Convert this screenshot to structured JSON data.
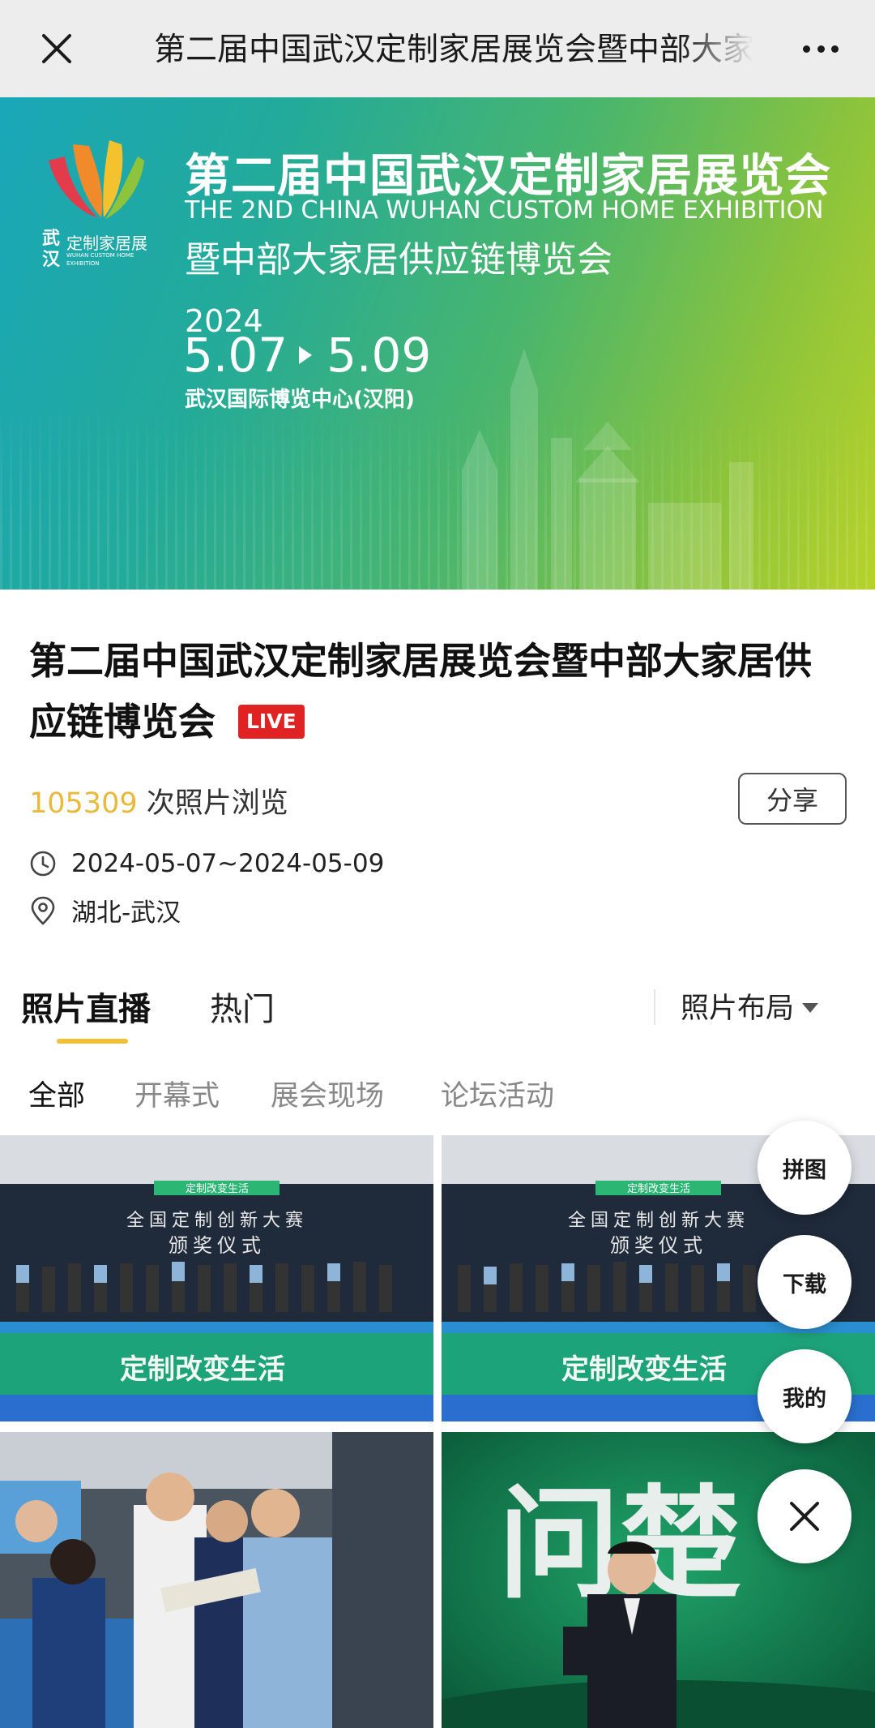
{
  "navbar": {
    "title": "第二届中国武汉定制家居展览会暨中部大家居供应链博览会",
    "close_icon": "close-icon",
    "more_icon": "more-dots-icon"
  },
  "banner": {
    "logo_city": "武汉",
    "logo_name": "定制家居展",
    "logo_en": "WUHAN CUSTOM HOME EXHIBITION",
    "title": "第二届中国武汉定制家居展览会",
    "title_en": "THE 2ND CHINA WUHAN CUSTOM HOME EXHIBITION",
    "subtitle": "暨中部大家居供应链博览会",
    "year": "2024",
    "date_start": "5.07",
    "date_end": "5.09",
    "venue": "武汉国际博览中心(汉阳)"
  },
  "event": {
    "title": "第二届中国武汉定制家居展览会暨中部大家居供应链博览会",
    "live_badge": "LIVE",
    "view_count": "105309",
    "view_suffix": "次照片浏览",
    "share_label": "分享",
    "date_range": "2024-05-07~2024-05-09",
    "location": "湖北-武汉"
  },
  "tabs": {
    "items": [
      {
        "label": "照片直播",
        "active": true
      },
      {
        "label": "热门",
        "active": false
      }
    ],
    "layout_label": "照片布局"
  },
  "categories": [
    {
      "label": "全部",
      "active": true
    },
    {
      "label": "开幕式",
      "active": false
    },
    {
      "label": "展会现场",
      "active": false
    },
    {
      "label": "论坛活动",
      "active": false
    }
  ],
  "photos": {
    "p1": {
      "screen_title": "全国定制创新大赛",
      "screen_subtitle": "颁奖仪式",
      "floor_text": "定制改变生活",
      "top_banner": "定制改变生活"
    },
    "p2": {
      "screen_title": "全国定制创新大赛",
      "screen_subtitle": "颁奖仪式",
      "floor_text": "定制改变生活",
      "top_banner": "定制改变生活"
    },
    "p4": {
      "bg_text": "问楚"
    }
  },
  "fab": {
    "collage_label": "拼图",
    "download_label": "下载",
    "mine_label": "我的",
    "close_icon": "close-icon"
  },
  "colors": {
    "accent_yellow": "#f2c033",
    "view_count": "#e8b93a",
    "live_red": "#e02222",
    "navbar_bg": "#ededed"
  }
}
